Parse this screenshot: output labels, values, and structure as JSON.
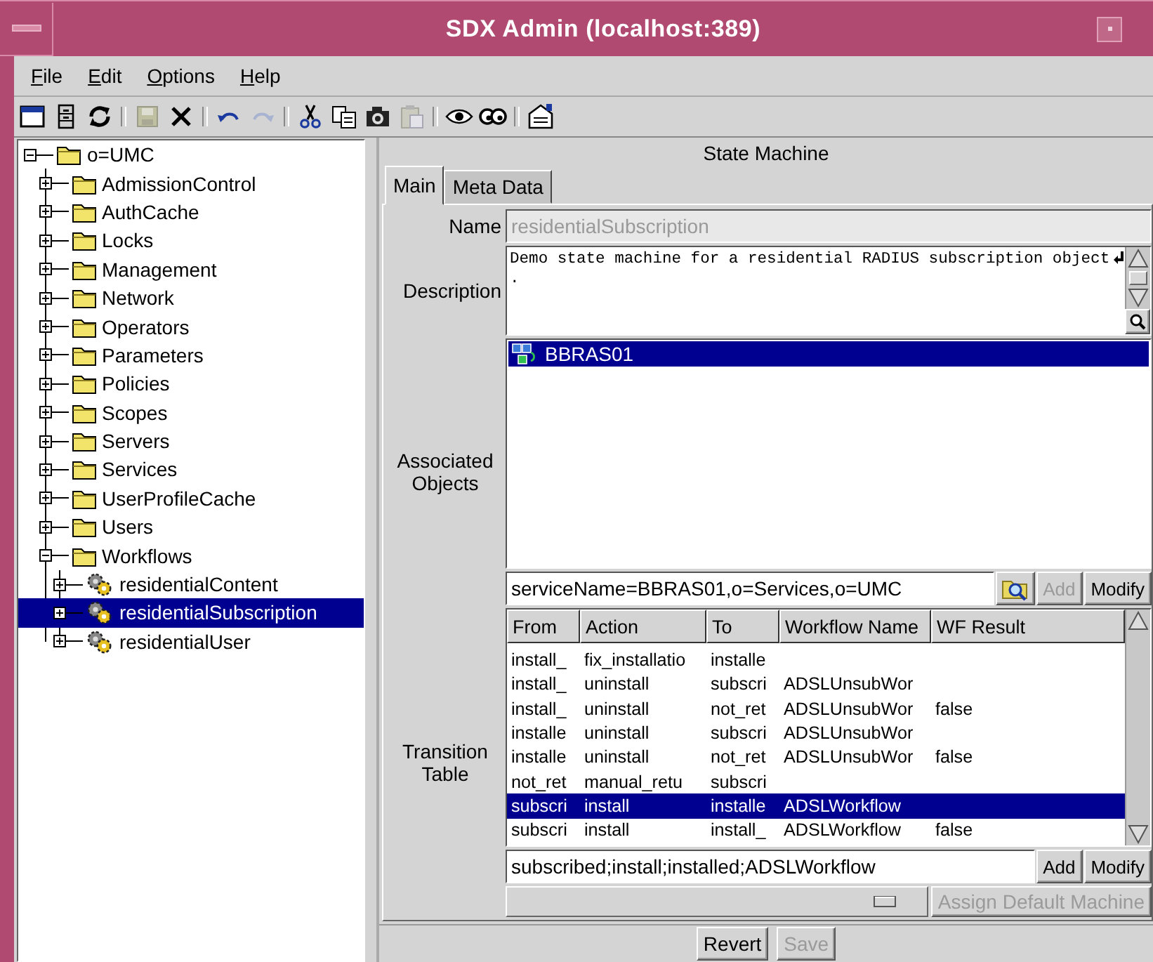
{
  "window": {
    "title": "SDX Admin (localhost:389)"
  },
  "menu": [
    {
      "label": "File"
    },
    {
      "label": "Edit"
    },
    {
      "label": "Options"
    },
    {
      "label": "Help"
    }
  ],
  "toolbar": [
    [
      {
        "kind": "window",
        "disabled": false
      },
      {
        "kind": "cabinet",
        "disabled": false
      },
      {
        "kind": "refresh",
        "disabled": false
      }
    ],
    [
      {
        "kind": "save",
        "disabled": true
      },
      {
        "kind": "delete",
        "disabled": false
      }
    ],
    [
      {
        "kind": "undo",
        "disabled": false
      },
      {
        "kind": "redo",
        "disabled": true
      }
    ],
    [
      {
        "kind": "cut",
        "disabled": false
      },
      {
        "kind": "copy",
        "disabled": false
      },
      {
        "kind": "camera",
        "disabled": false
      },
      {
        "kind": "paste",
        "disabled": true
      }
    ],
    [
      {
        "kind": "eye",
        "disabled": false
      },
      {
        "kind": "glasses",
        "disabled": false
      }
    ],
    [
      {
        "kind": "properties",
        "disabled": false
      }
    ]
  ],
  "tree": [
    {
      "label": "o=UMC",
      "kind": "folder",
      "expanded": true,
      "selected": false,
      "children": [
        {
          "label": "AdmissionControl",
          "kind": "folder",
          "expanded": false,
          "selected": false
        },
        {
          "label": "AuthCache",
          "kind": "folder",
          "expanded": false,
          "selected": false
        },
        {
          "label": "Locks",
          "kind": "folder",
          "expanded": false,
          "selected": false
        },
        {
          "label": "Management",
          "kind": "folder",
          "expanded": false,
          "selected": false
        },
        {
          "label": "Network",
          "kind": "folder",
          "expanded": false,
          "selected": false
        },
        {
          "label": "Operators",
          "kind": "folder",
          "expanded": false,
          "selected": false
        },
        {
          "label": "Parameters",
          "kind": "folder",
          "expanded": false,
          "selected": false
        },
        {
          "label": "Policies",
          "kind": "folder",
          "expanded": false,
          "selected": false
        },
        {
          "label": "Scopes",
          "kind": "folder",
          "expanded": false,
          "selected": false
        },
        {
          "label": "Servers",
          "kind": "folder",
          "expanded": false,
          "selected": false
        },
        {
          "label": "Services",
          "kind": "folder",
          "expanded": false,
          "selected": false
        },
        {
          "label": "UserProfileCache",
          "kind": "folder",
          "expanded": false,
          "selected": false
        },
        {
          "label": "Users",
          "kind": "folder",
          "expanded": false,
          "selected": false
        },
        {
          "label": "Workflows",
          "kind": "folder",
          "expanded": true,
          "selected": false,
          "children": [
            {
              "label": "residentialContent",
              "kind": "workflow",
              "expanded": false,
              "selected": false
            },
            {
              "label": "residentialSubscription",
              "kind": "workflow",
              "expanded": false,
              "selected": true
            },
            {
              "label": "residentialUser",
              "kind": "workflow",
              "expanded": false,
              "selected": false
            }
          ]
        }
      ]
    }
  ],
  "panel": {
    "title": "State Machine",
    "tabs": [
      {
        "label": "Main",
        "selected": true
      },
      {
        "label": "Meta Data",
        "selected": false
      }
    ],
    "name": {
      "label": "Name",
      "value": "residentialSubscription",
      "disabled": true
    },
    "description": {
      "label": "Description",
      "lines": [
        "Demo state machine for a residential RADIUS subscription object",
        "."
      ]
    },
    "associated_objects": {
      "label": "Associated Objects",
      "items": [
        {
          "label": "BBRAS01",
          "selected": true
        }
      ],
      "field": {
        "value": "serviceName=BBRAS01,o=Services,o=UMC"
      },
      "buttons": [
        {
          "label": "Add",
          "disabled": true
        },
        {
          "label": "Modify",
          "disabled": false
        }
      ]
    },
    "transition_table": {
      "label": "Transition Table",
      "columns": [
        "From",
        "Action",
        "To",
        "Workflow Name",
        "WF Result"
      ],
      "rows": [
        {
          "cells": [
            "install_",
            "fix_installatio",
            "installe",
            "",
            ""
          ],
          "selected": false
        },
        {
          "cells": [
            "install_",
            "uninstall",
            "subscri",
            "ADSLUnsubWor",
            ""
          ],
          "selected": false
        },
        {
          "cells": [
            "install_",
            "uninstall",
            "not_ret",
            "ADSLUnsubWor",
            "false"
          ],
          "selected": false
        },
        {
          "cells": [
            "installe",
            "uninstall",
            "subscri",
            "ADSLUnsubWor",
            ""
          ],
          "selected": false
        },
        {
          "cells": [
            "installe",
            "uninstall",
            "not_ret",
            "ADSLUnsubWor",
            "false"
          ],
          "selected": false
        },
        {
          "cells": [
            "not_ret",
            "manual_retu",
            "subscri",
            "",
            ""
          ],
          "selected": false
        },
        {
          "cells": [
            "subscri",
            "install",
            "installe",
            "ADSLWorkflow",
            ""
          ],
          "selected": true
        },
        {
          "cells": [
            "subscri",
            "install",
            "install_",
            "ADSLWorkflow",
            "false"
          ],
          "selected": false
        }
      ],
      "field": {
        "value": "subscribed;install;installed;ADSLWorkflow"
      },
      "buttons": [
        {
          "label": "Add",
          "disabled": false
        },
        {
          "label": "Modify",
          "disabled": false
        }
      ]
    },
    "assign_button": {
      "label": "Assign Default Machine",
      "disabled": true
    }
  },
  "footer_buttons": [
    {
      "label": "Revert",
      "disabled": false
    },
    {
      "label": "Save",
      "disabled": true
    }
  ]
}
